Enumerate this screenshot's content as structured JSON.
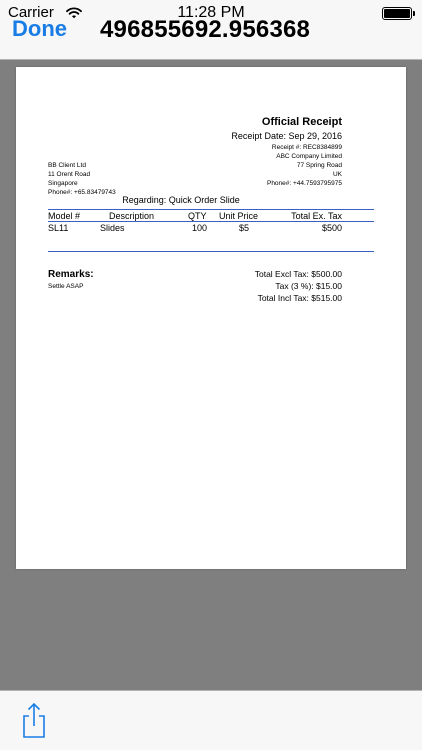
{
  "status_bar": {
    "carrier": "Carrier",
    "time": "11:28 PM"
  },
  "nav": {
    "done_label": "Done",
    "title": "496855692.956368",
    "accent": "#1a7de6"
  },
  "receipt": {
    "heading": "Official Receipt",
    "date": "Receipt Date: Sep 29, 2016",
    "receipt_no": "Receipt #: REC8384899",
    "company": "ABC Company Limited",
    "street": "77 Spring Road",
    "country": "UK",
    "phone": "Phone#: +44.7593795975",
    "client": {
      "name": "BB Client Ltd",
      "street": "11 Orent Road",
      "city": "Singapore",
      "phone": "Phone#: +65.83479743"
    },
    "regarding": "Regarding: Quick Order Slide",
    "columns": [
      "Model #",
      "Description",
      "QTY",
      "Unit Price",
      "Total Ex. Tax"
    ],
    "rows": [
      [
        "SL11",
        "Slides",
        "100",
        "$5",
        "$500"
      ]
    ],
    "remarks_label": "Remarks:",
    "remarks": "Settle ASAP",
    "total_excl": "Total Excl Tax: $500.00",
    "tax": "Tax (3 %): $15.00",
    "total_incl": "Total Incl Tax: $515.00",
    "rule_color": "#3b5fc4"
  },
  "toolbar": {
    "share_icon": "share-icon"
  }
}
